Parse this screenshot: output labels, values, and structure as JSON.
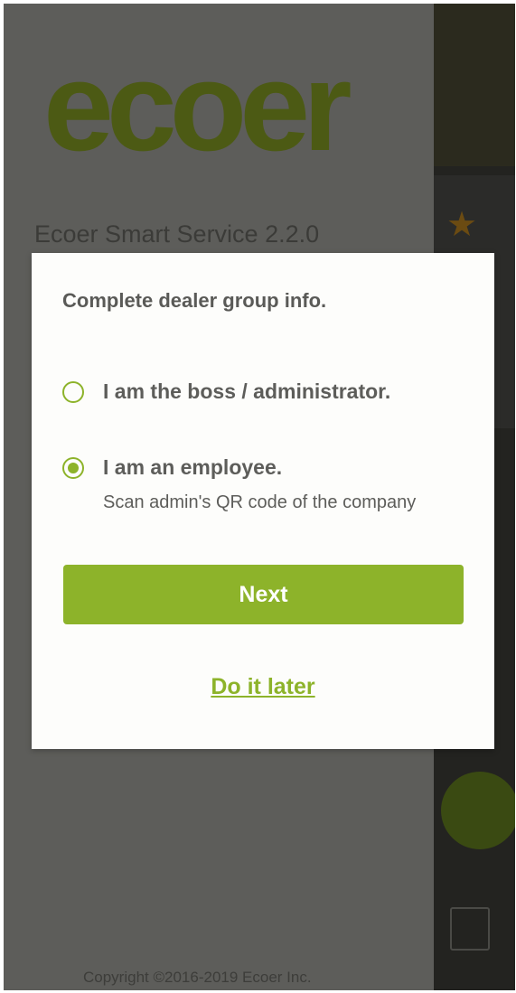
{
  "drawer": {
    "logo_text": "ecoer",
    "app_version": "Ecoer Smart Service 2.2.0",
    "copyright": "Copyright ©2016-2019 Ecoer Inc."
  },
  "dialog": {
    "title": "Complete dealer group info.",
    "options": [
      {
        "label": "I am the boss / administrator.",
        "selected": false
      },
      {
        "label": "I am an employee.",
        "selected": true,
        "sublabel": "Scan admin's QR code of the company"
      }
    ],
    "next_label": "Next",
    "later_label": "Do it later"
  },
  "colors": {
    "accent": "#8db32a",
    "logo_olive": "#4c5a14",
    "logo_dark": "#1f1f1d",
    "scrim": "#5a5a57"
  }
}
